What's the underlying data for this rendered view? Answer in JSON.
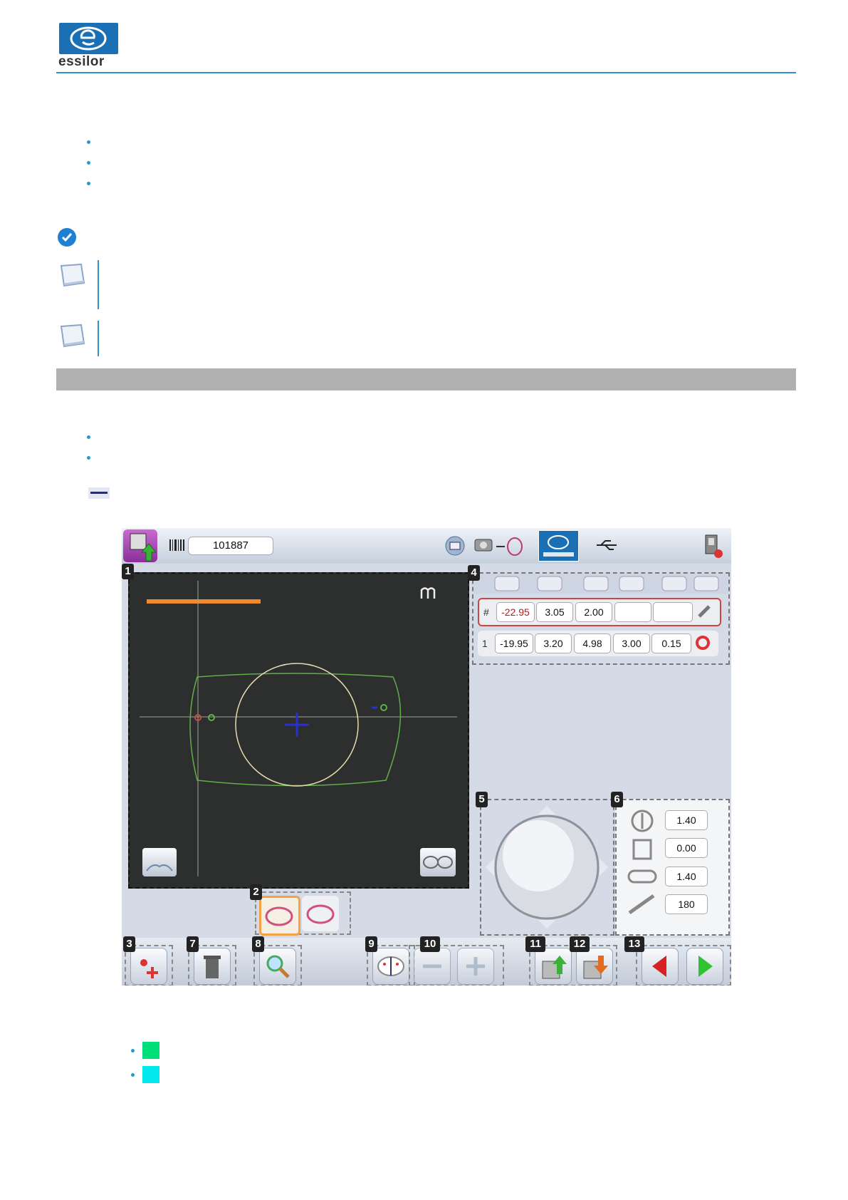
{
  "header": {
    "brand": "essilor"
  },
  "screen": {
    "job_number": "101887",
    "callouts": [
      "1",
      "2",
      "3",
      "4",
      "5",
      "6",
      "7",
      "8",
      "9",
      "10",
      "11",
      "12",
      "13"
    ],
    "row_hash": {
      "marker": "#",
      "values": [
        "-22.95",
        "3.05",
        "2.00",
        "",
        ""
      ]
    },
    "row_1": {
      "marker": "1",
      "values": [
        "-19.95",
        "3.20",
        "4.98",
        "3.00",
        "0.15"
      ]
    },
    "panel6_values": [
      "1.40",
      "0.00",
      "1.40",
      "180"
    ]
  },
  "legend": {
    "colors": [
      "#00e07a",
      "#00e8ee"
    ]
  },
  "icons": {
    "check": "check-circle-icon",
    "note": "note-icon",
    "logo": "essilor-logo-icon"
  }
}
